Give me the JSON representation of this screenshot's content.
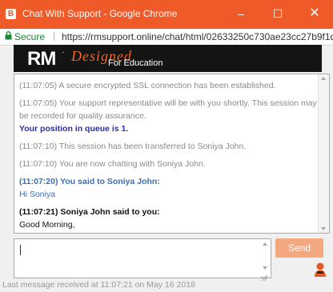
{
  "window": {
    "app_icon": "B",
    "title": "Chat With Support - Google Chrome",
    "minimize": "–",
    "maximize": "☐",
    "close": "✕"
  },
  "address": {
    "secure_label": "Secure",
    "separator": "|",
    "url": "https://rmsupport.online/chat/html/02633250c730ae23cc27b9f1d2f..."
  },
  "banner": {
    "logo_text": "RM",
    "logo_mark": "·",
    "tag_designed": "Designed",
    "tag_for": "For Education"
  },
  "chat": {
    "messages": [
      {
        "kind": "system",
        "text": "(11:07:05) A secure encrypted SSL connection has been established."
      },
      {
        "kind": "system",
        "text": "(11:07:05) Your support representative will be with you shortly. This session may be recorded for quality assurance."
      },
      {
        "kind": "queue",
        "text": "Your position in queue is 1."
      },
      {
        "kind": "system",
        "text": "(11:07:10) This session has been transferred to Soniya John."
      },
      {
        "kind": "system",
        "text": "(11:07:10) You are now chatting with Soniya John."
      },
      {
        "kind": "you",
        "header": "(11:07:20) You said to Soniya John:",
        "body": "Hi Soniya"
      },
      {
        "kind": "agent",
        "header": "(11:07:21) Soniya John said to you:",
        "body": "Good Morning,"
      }
    ]
  },
  "compose": {
    "input_value": "",
    "send_label": "Send"
  },
  "status_text": "Last message received at 11:07:21 on May 16 2018",
  "colors": {
    "brand": "#ef5a29",
    "send_disabled": "#f4a87f",
    "you_blue": "#3a6fb5",
    "queue_blue": "#2a2ab8",
    "secure_green": "#1a8a34"
  }
}
